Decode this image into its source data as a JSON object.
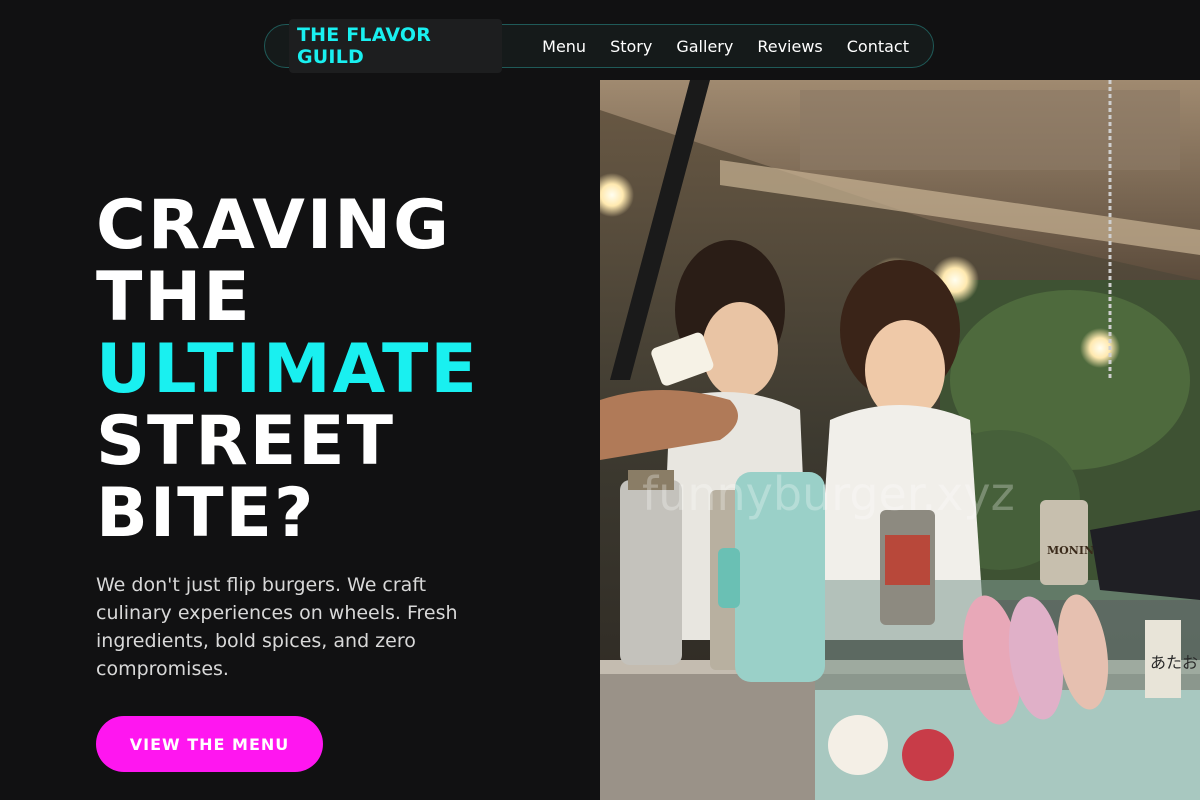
{
  "nav": {
    "logo": "THE FLAVOR GUILD",
    "links": [
      "Menu",
      "Story",
      "Gallery",
      "Reviews",
      "Contact"
    ]
  },
  "hero": {
    "line1": "CRAVING",
    "line2": "THE",
    "line3": "ULTIMATE",
    "line4": "STREET",
    "line5": "BITE?",
    "lead": "We don't just flip burgers. We craft culinary experiences on wheels. Fresh ingredients, bold spices, and zero compromises.",
    "cta": "VIEW THE MENU"
  },
  "photo": {
    "watermark": "funnyburger.xyz",
    "sign_brand": "MONIN",
    "sign_right": "あたお"
  },
  "colors": {
    "accent": "#19f0f0",
    "cta": "#ff16f0",
    "background": "#111112"
  }
}
